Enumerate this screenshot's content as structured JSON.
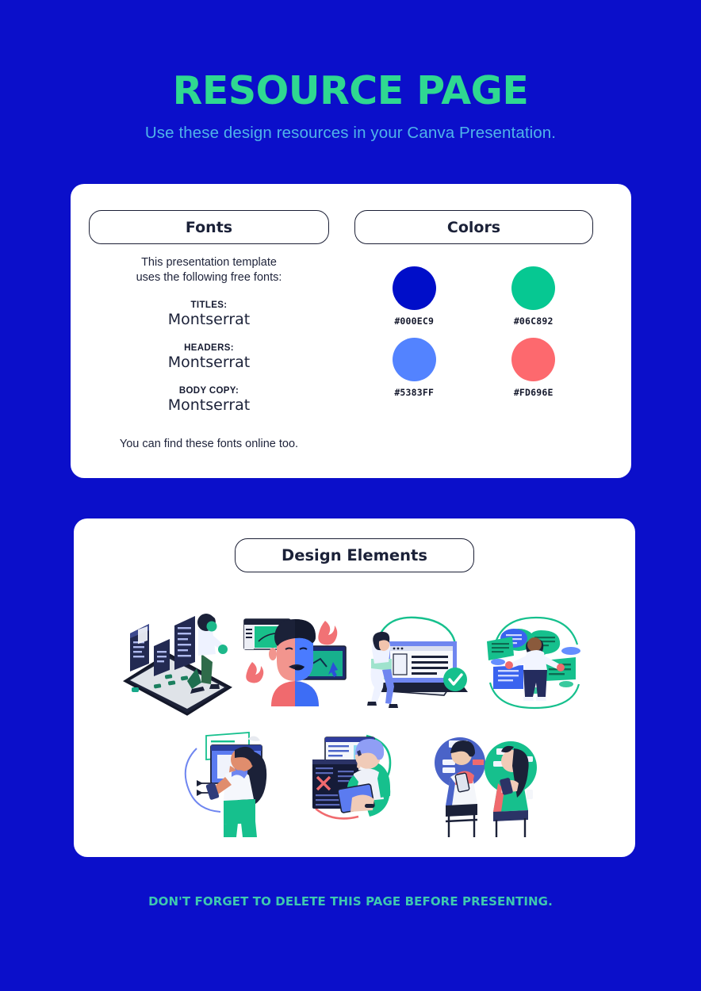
{
  "page": {
    "background_color": "#0b0fca",
    "title": "RESOURCE PAGE",
    "title_color": "#2fd891",
    "subtitle": "Use these design resources in your Canva Presentation.",
    "subtitle_color": "#4fb4e8",
    "footer": "DON'T FORGET TO DELETE THIS PAGE BEFORE PRESENTING.",
    "footer_color": "#3ec9b0"
  },
  "fonts_panel": {
    "heading": "Fonts",
    "intro_line_1": "This presentation template",
    "intro_line_2": "uses the following free fonts:",
    "groups": [
      {
        "role": "TITLES:",
        "name": "Montserrat"
      },
      {
        "role": "HEADERS:",
        "name": "Montserrat"
      },
      {
        "role": "BODY COPY:",
        "name": "Montserrat"
      }
    ],
    "footnote": "You can find these fonts online too."
  },
  "colors_panel": {
    "heading": "Colors",
    "swatches": [
      {
        "hex": "#000EC9",
        "label": "#000EC9",
        "name": "swatch-dark-blue"
      },
      {
        "hex": "#06C892",
        "label": "#06C892",
        "name": "swatch-green"
      },
      {
        "hex": "#5383FF",
        "label": "#5383FF",
        "name": "swatch-light-blue"
      },
      {
        "hex": "#FD696E",
        "label": "#FD696E",
        "name": "swatch-coral"
      }
    ]
  },
  "design_elements_panel": {
    "heading": "Design Elements",
    "illustrations": [
      {
        "name": "illustration-person-walking-on-tablet",
        "alt": "Person walking across a tablet with document panels"
      },
      {
        "name": "illustration-split-face-with-windows",
        "alt": "Face split red and blue with browser windows and flames"
      },
      {
        "name": "illustration-laptop-with-checkmark",
        "alt": "Person at a laptop with a green check mark"
      },
      {
        "name": "illustration-person-with-speech-bubbles",
        "alt": "Person surrounded by floating documents and speech bubbles"
      },
      {
        "name": "illustration-woman-with-phone-and-screens",
        "alt": "Woman holding a phone in front of interface screens"
      },
      {
        "name": "illustration-person-tablet-red-x",
        "alt": "Person with tablet beside a dark window showing a red X"
      },
      {
        "name": "illustration-two-people-on-phones",
        "alt": "Two people on phones inside blue and green circles"
      }
    ]
  }
}
